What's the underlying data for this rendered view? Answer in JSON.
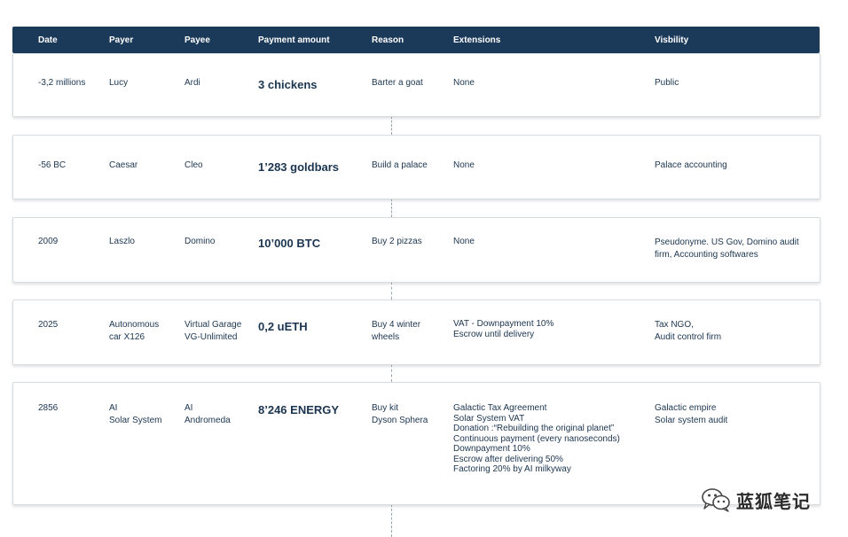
{
  "header": {
    "date": "Date",
    "payer": "Payer",
    "payee": "Payee",
    "amount": "Payment amount",
    "reason": "Reason",
    "extensions": "Extensions",
    "visibility": "Visbility"
  },
  "rows": [
    {
      "date": "-3,2 millions",
      "payer": "Lucy",
      "payee": "Ardi",
      "amount": "3 chickens",
      "reason": "Barter a goat",
      "extensions": "None",
      "visibility": "Public"
    },
    {
      "date": "-56 BC",
      "payer": "Caesar",
      "payee": "Cleo",
      "amount": "1’283 goldbars",
      "reason": "Build a palace",
      "extensions": "None",
      "visibility": "Palace accounting"
    },
    {
      "date": "2009",
      "payer": "Laszlo",
      "payee": "Domino",
      "amount": "10’000 BTC",
      "reason": "Buy 2 pizzas",
      "extensions": "None",
      "visibility": "Pseudonyme. US Gov, Domino audit\nfirm, Accounting softwares"
    },
    {
      "date": "2025",
      "payer": "Autonomous\ncar X126",
      "payee": "Virtual Garage\nVG-Unlimited",
      "amount": "0,2 uETH",
      "reason": "Buy 4 winter\nwheels",
      "extensions": "VAT - Downpayment 10%\nEscrow until delivery",
      "visibility": "Tax NGO,\nAudit control firm"
    },
    {
      "date": "2856",
      "payer": "AI\nSolar System",
      "payee": "AI\nAndromeda",
      "amount": "8’246 ENERGY",
      "reason": "Buy kit\nDyson Sphera",
      "extensions": "Galactic Tax Agreement\nSolar System VAT\nDonation :“Rebuilding the original planet”\nContinuous payment (every nanoseconds)\nDownpayment 10%\nEscrow after delivering 50%\nFactoring 20% by AI milkyway",
      "visibility": "Galactic empire\nSolar system audit"
    }
  ],
  "watermark": {
    "text": "蓝狐笔记",
    "icon": "wechat-icon"
  }
}
